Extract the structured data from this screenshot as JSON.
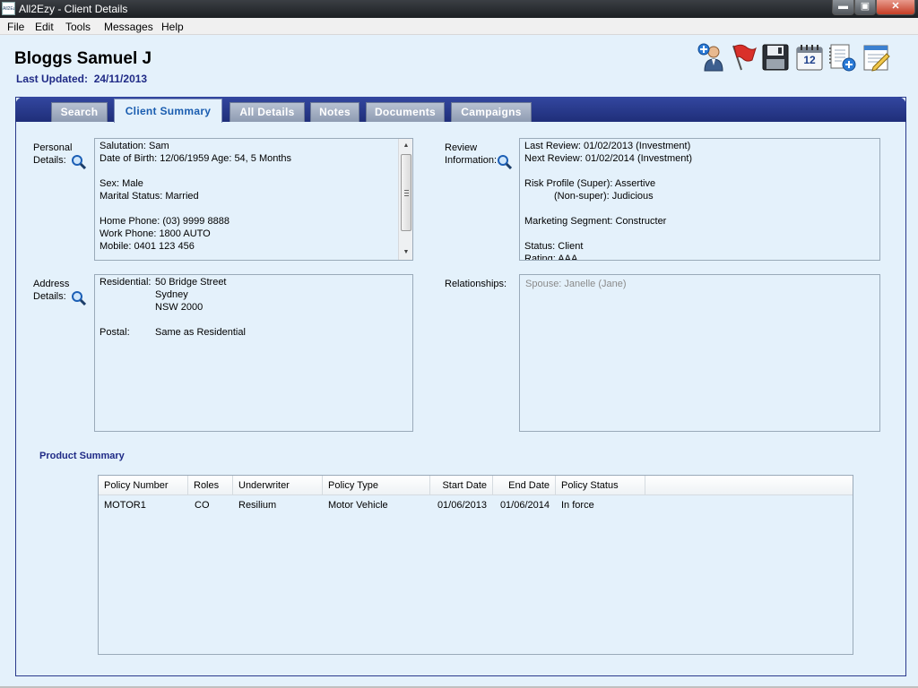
{
  "window": {
    "title": "All2Ezy - Client Details",
    "app_icon_text": "All2Ezy",
    "min": "▬",
    "max": "▣",
    "close": "✕"
  },
  "menu": [
    "File",
    "Edit",
    "Tools",
    "Messages",
    "Help"
  ],
  "header": {
    "client_name": "Bloggs Samuel J",
    "last_updated_label": "Last Updated:",
    "last_updated_value": "24/11/2013"
  },
  "toolbar": {
    "icons": [
      "add-client-icon",
      "flag-icon",
      "save-icon",
      "calendar-icon",
      "add-document-icon",
      "edit-notes-icon"
    ],
    "calendar_day": "12"
  },
  "tabs": [
    {
      "label": "Search",
      "active": false
    },
    {
      "label": "Client Summary",
      "active": true
    },
    {
      "label": "All Details",
      "active": false
    },
    {
      "label": "Notes",
      "active": false
    },
    {
      "label": "Documents",
      "active": false
    },
    {
      "label": "Campaigns",
      "active": false
    }
  ],
  "personal": {
    "label_1": "Personal",
    "label_2": "Details:",
    "lines": [
      "Salutation: Sam",
      "Date of Birth: 12/06/1959   Age: 54, 5 Months",
      "Sex: Male",
      "Marital Status: Married",
      "Home Phone: (03) 9999 8888",
      "Work Phone: 1800 AUTO",
      "Mobile: 0401 123 456"
    ]
  },
  "review": {
    "label_1": "Review",
    "label_2": "Information:",
    "lines": [
      "Last Review: 01/02/2013 (Investment)",
      "Next Review: 01/02/2014 (Investment)",
      "Risk Profile (Super): Assertive",
      "(Non-super): Judicious",
      "Marketing Segment: Constructer",
      "Status: Client",
      "Rating: AAA"
    ]
  },
  "address": {
    "label_1": "Address",
    "label_2": "Details:",
    "residential_label": "Residential:",
    "residential_lines": [
      "50 Bridge Street",
      "Sydney",
      "NSW 2000"
    ],
    "postal_label": "Postal:",
    "postal_value": "Same as Residential"
  },
  "relationships": {
    "label": "Relationships:",
    "spouse": "Spouse: Janelle (Jane)"
  },
  "products": {
    "title": "Product Summary",
    "columns": [
      "Policy Number",
      "Roles",
      "Underwriter",
      "Policy Type",
      "Start Date",
      "End Date",
      "Policy Status"
    ],
    "rows": [
      [
        "MOTOR1",
        "CO",
        "Resilium",
        "Motor Vehicle",
        "01/06/2013",
        "01/06/2014",
        "In force"
      ]
    ]
  }
}
